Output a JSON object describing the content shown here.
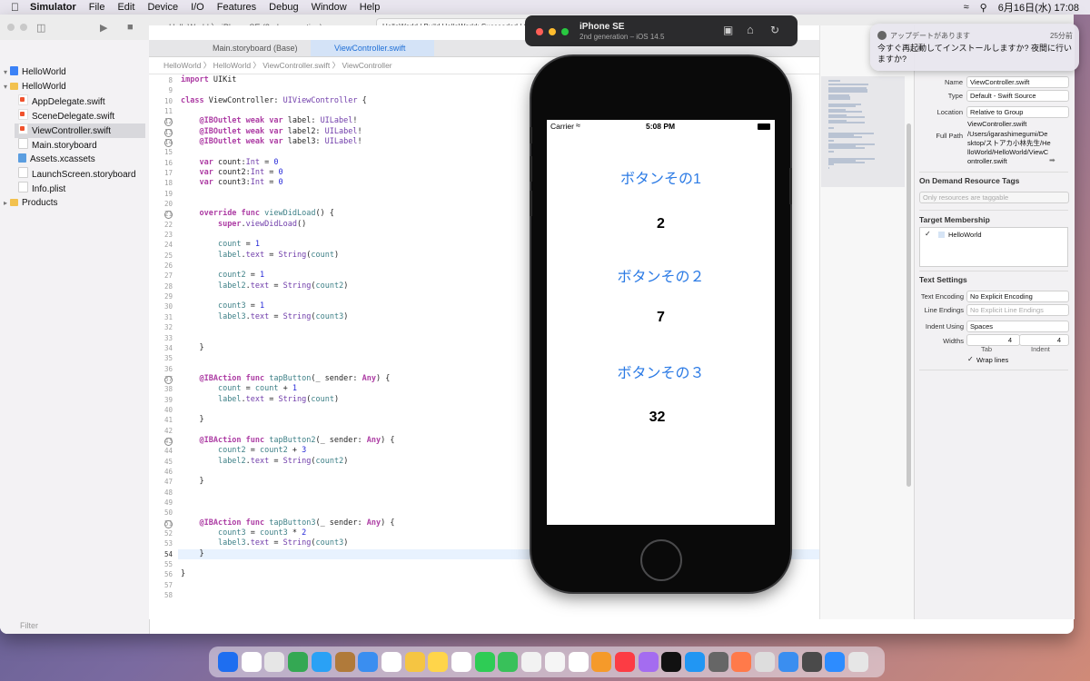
{
  "menubar": {
    "app": "Simulator",
    "items": [
      "File",
      "Edit",
      "Device",
      "I/O",
      "Features",
      "Debug",
      "Window",
      "Help"
    ],
    "clock": "6月16日(水)  17:08"
  },
  "toolbar": {
    "scheme": "HelloWorld 〉 iPhone SE (2nd generation)",
    "status": "HelloWorld | Build HelloWorld: Succeeded | 6"
  },
  "navigator": {
    "project": "HelloWorld",
    "group": "HelloWorld",
    "files": [
      "AppDelegate.swift",
      "SceneDelegate.swift",
      "ViewController.swift",
      "Main.storyboard",
      "Assets.xcassets",
      "LaunchScreen.storyboard",
      "Info.plist"
    ],
    "products": "Products",
    "filter_placeholder": "Filter"
  },
  "tabs": {
    "tab1": "Main.storyboard (Base)",
    "tab2": "ViewController.swift"
  },
  "jumpbar": "HelloWorld 〉 HelloWorld 〉 ViewController.swift 〉 ViewController",
  "code": {
    "current_line": 54,
    "lines": [
      {
        "n": "8",
        "html": "<span class=\"kw\">import</span> UIKit"
      },
      {
        "n": "9",
        "html": ""
      },
      {
        "n": "10",
        "html": "<span class=\"kw\">class</span> ViewController: <span class=\"ty\">UIViewController</span> {"
      },
      {
        "n": "11",
        "html": ""
      },
      {
        "n": "12",
        "html": "    <span class=\"kw\">@IBOutlet weak var</span> label: <span class=\"ty\">UILabel</span>!"
      },
      {
        "n": "13",
        "html": "    <span class=\"kw\">@IBOutlet weak var</span> label2: <span class=\"ty\">UILabel</span>!"
      },
      {
        "n": "14",
        "html": "    <span class=\"kw\">@IBOutlet weak var</span> label3: <span class=\"ty\">UILabel</span>!"
      },
      {
        "n": "15",
        "html": ""
      },
      {
        "n": "16",
        "html": "    <span class=\"kw\">var</span> count:<span class=\"ty\">Int</span> = <span class=\"nu\">0</span>"
      },
      {
        "n": "17",
        "html": "    <span class=\"kw\">var</span> count2:<span class=\"ty\">Int</span> = <span class=\"nu\">0</span>"
      },
      {
        "n": "18",
        "html": "    <span class=\"kw\">var</span> count3:<span class=\"ty\">Int</span> = <span class=\"nu\">0</span>"
      },
      {
        "n": "19",
        "html": ""
      },
      {
        "n": "20",
        "html": ""
      },
      {
        "n": "21",
        "html": "    <span class=\"kw\">override func</span> <span class=\"fn\">viewDidLoad</span>() {"
      },
      {
        "n": "22",
        "html": "        <span class=\"kw\">super</span>.<span class=\"ty\">viewDidLoad</span>()"
      },
      {
        "n": "23",
        "html": ""
      },
      {
        "n": "24",
        "html": "        <span class=\"fn\">count</span> = <span class=\"nu\">1</span>"
      },
      {
        "n": "25",
        "html": "        <span class=\"fn\">label</span>.<span class=\"ty\">text</span> = <span class=\"ty\">String</span>(<span class=\"fn\">count</span>)"
      },
      {
        "n": "26",
        "html": ""
      },
      {
        "n": "27",
        "html": "        <span class=\"fn\">count2</span> = <span class=\"nu\">1</span>"
      },
      {
        "n": "28",
        "html": "        <span class=\"fn\">label2</span>.<span class=\"ty\">text</span> = <span class=\"ty\">String</span>(<span class=\"fn\">count2</span>)"
      },
      {
        "n": "29",
        "html": ""
      },
      {
        "n": "30",
        "html": "        <span class=\"fn\">count3</span> = <span class=\"nu\">1</span>"
      },
      {
        "n": "31",
        "html": "        <span class=\"fn\">label3</span>.<span class=\"ty\">text</span> = <span class=\"ty\">String</span>(<span class=\"fn\">count3</span>)"
      },
      {
        "n": "32",
        "html": ""
      },
      {
        "n": "33",
        "html": ""
      },
      {
        "n": "34",
        "html": "    }"
      },
      {
        "n": "35",
        "html": ""
      },
      {
        "n": "36",
        "html": ""
      },
      {
        "n": "37",
        "html": "    <span class=\"kw\">@IBAction func</span> <span class=\"fn\">tapButton</span>(_ sender: <span class=\"kw\">Any</span>) {"
      },
      {
        "n": "38",
        "html": "        <span class=\"fn\">count</span> = <span class=\"fn\">count</span> + <span class=\"nu\">1</span>"
      },
      {
        "n": "39",
        "html": "        <span class=\"fn\">label</span>.<span class=\"ty\">text</span> = <span class=\"ty\">String</span>(<span class=\"fn\">count</span>)"
      },
      {
        "n": "40",
        "html": ""
      },
      {
        "n": "41",
        "html": "    }"
      },
      {
        "n": "42",
        "html": ""
      },
      {
        "n": "43",
        "html": "    <span class=\"kw\">@IBAction func</span> <span class=\"fn\">tapButton2</span>(_ sender: <span class=\"kw\">Any</span>) {"
      },
      {
        "n": "44",
        "html": "        <span class=\"fn\">count2</span> = <span class=\"fn\">count2</span> + <span class=\"nu\">3</span>"
      },
      {
        "n": "45",
        "html": "        <span class=\"fn\">label2</span>.<span class=\"ty\">text</span> = <span class=\"ty\">String</span>(<span class=\"fn\">count2</span>)"
      },
      {
        "n": "46",
        "html": ""
      },
      {
        "n": "47",
        "html": "    }"
      },
      {
        "n": "48",
        "html": ""
      },
      {
        "n": "49",
        "html": ""
      },
      {
        "n": "50",
        "html": ""
      },
      {
        "n": "51",
        "html": "    <span class=\"kw\">@IBAction func</span> <span class=\"fn\">tapButton3</span>(_ sender: <span class=\"kw\">Any</span>) {"
      },
      {
        "n": "52",
        "html": "        <span class=\"fn\">count3</span> = <span class=\"fn\">count3</span> * <span class=\"nu\">2</span>"
      },
      {
        "n": "53",
        "html": "        <span class=\"fn\">label3</span>.<span class=\"ty\">text</span> = <span class=\"ty\">String</span>(<span class=\"fn\">count3</span>)"
      },
      {
        "n": "54",
        "html": "    }"
      },
      {
        "n": "55",
        "html": ""
      },
      {
        "n": "56",
        "html": "}"
      },
      {
        "n": "57",
        "html": ""
      },
      {
        "n": "58",
        "html": ""
      }
    ],
    "breakpoints": [
      "12",
      "13",
      "14",
      "21",
      "37",
      "43",
      "51"
    ]
  },
  "inspector": {
    "name_label": "Name",
    "name_value": "ViewController.swift",
    "type_label": "Type",
    "type_value": "Default - Swift Source",
    "location_label": "Location",
    "location_value": "Relative to Group",
    "location_file": "ViewController.swift",
    "fullpath_label": "Full Path",
    "fullpath_value": "/Users/igarashimegumi/Desktop/ストアカ小林先生/HelloWorld/HelloWorld/ViewController.swift",
    "odr_title": "On Demand Resource Tags",
    "odr_placeholder": "Only resources are taggable",
    "membership_title": "Target Membership",
    "membership_target": "HelloWorld",
    "text_settings_title": "Text Settings",
    "encoding_label": "Text Encoding",
    "encoding_value": "No Explicit Encoding",
    "endings_label": "Line Endings",
    "endings_value": "No Explicit Line Endings",
    "indent_label": "Indent Using",
    "indent_value": "Spaces",
    "widths_label": "Widths",
    "tab_value": "4",
    "indent_num": "4",
    "tab_caption": "Tab",
    "indent_caption": "Indent",
    "wrap_label": "Wrap lines"
  },
  "notification": {
    "app": "アップデートがあります",
    "time": "25分前",
    "body": "今すぐ再起動してインストールしますか? 夜間に行いますか?"
  },
  "simulator": {
    "device": "iPhone SE",
    "subtitle": "2nd generation – iOS 14.5",
    "carrier": "Carrier",
    "time": "5:08 PM",
    "button1": "ボタンその1",
    "label1": "2",
    "button2": "ボタンその２",
    "label2": "7",
    "button3": "ボタンその３",
    "label3": "32"
  },
  "colors": {
    "accent": "#2c7be5",
    "keyword": "#ad3da4",
    "type": "#703daa",
    "number": "#272ad8"
  }
}
